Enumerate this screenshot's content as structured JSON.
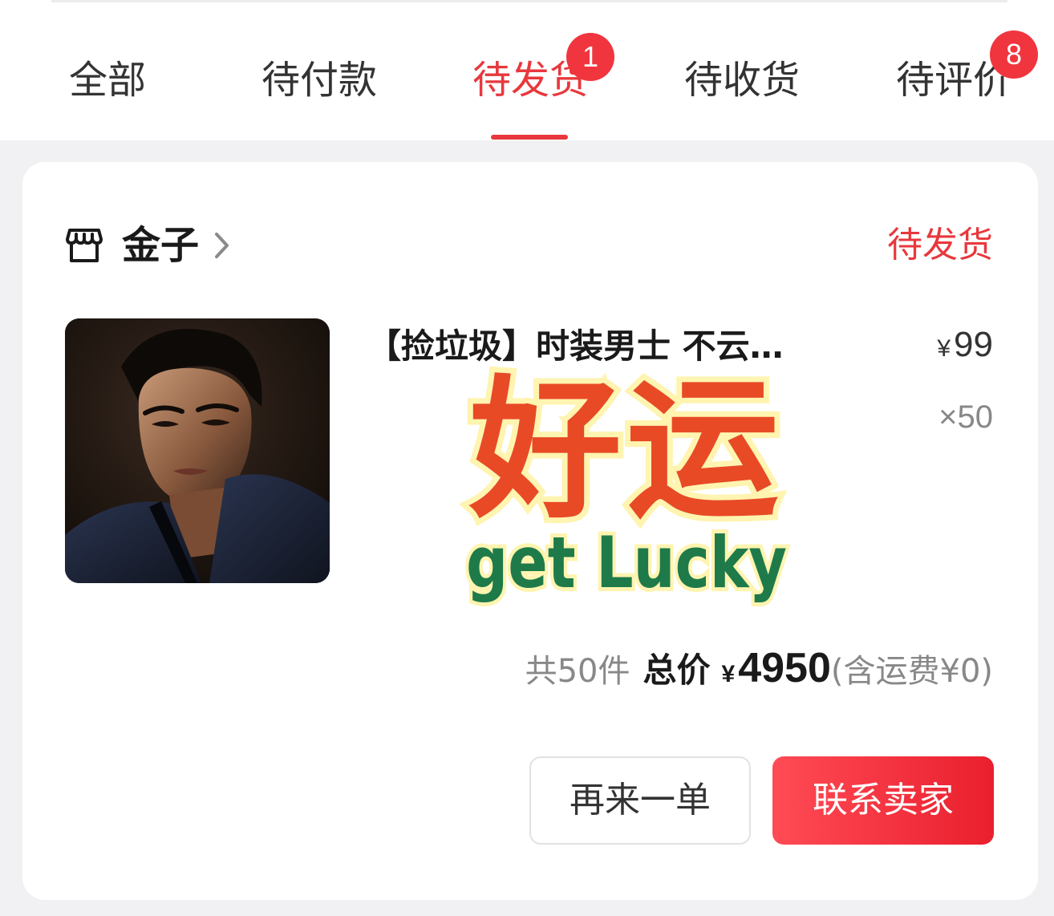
{
  "tabs": [
    {
      "label": "全部",
      "active": false,
      "badge": null
    },
    {
      "label": "待付款",
      "active": false,
      "badge": null
    },
    {
      "label": "待发货",
      "active": true,
      "badge": "1"
    },
    {
      "label": "待收货",
      "active": false,
      "badge": null
    },
    {
      "label": "待评价",
      "active": false,
      "badge": "8"
    }
  ],
  "order": {
    "shop_name": "金子",
    "status": "待发货",
    "product": {
      "title": "【捡垃圾】时装男士 不云…",
      "price_symbol": "¥",
      "price": "99",
      "quantity": "×50",
      "image": "portrait-photo"
    },
    "summary": {
      "count": "共50件",
      "total_label": "总价",
      "currency": "¥",
      "total": "4950",
      "shipping": "(含运费¥0)"
    },
    "actions": {
      "reorder": "再来一单",
      "contact": "联系卖家"
    }
  },
  "sticker": {
    "text_cn": "好运",
    "text_en": "get Lucky"
  },
  "colors": {
    "accent": "#e8383d",
    "sticker_red": "#e84a26",
    "sticker_green": "#1f7a4a",
    "sticker_glow": "#fff4b0"
  }
}
